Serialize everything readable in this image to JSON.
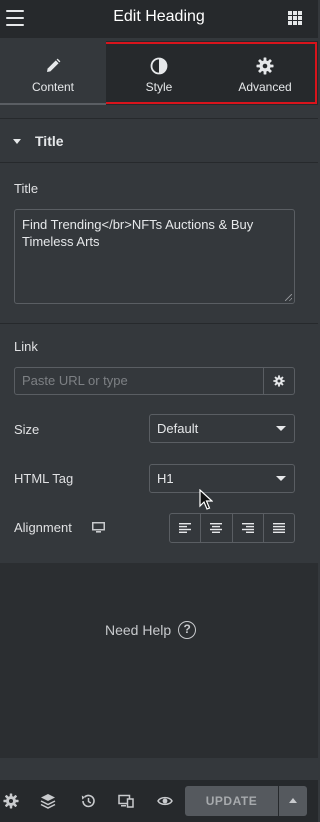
{
  "header": {
    "title": "Edit Heading",
    "menu_icon": "hamburger-icon",
    "apps_icon": "grid-icon"
  },
  "tabs": [
    {
      "label": "Content",
      "icon": "pencil-icon",
      "active": true
    },
    {
      "label": "Style",
      "icon": "contrast-icon",
      "active": false
    },
    {
      "label": "Advanced",
      "icon": "gear-icon",
      "active": false
    }
  ],
  "highlight_color": "#d8141c",
  "section": {
    "title": "Title"
  },
  "title_field": {
    "label": "Title",
    "value": "Find Trending</br>NFTs Auctions & Buy Timeless Arts"
  },
  "link_field": {
    "label": "Link",
    "placeholder": "Paste URL or type"
  },
  "size_field": {
    "label": "Size",
    "value": "Default"
  },
  "html_tag_field": {
    "label": "HTML Tag",
    "value": "H1"
  },
  "alignment_field": {
    "label": "Alignment",
    "options": [
      "left",
      "center",
      "right",
      "justify"
    ]
  },
  "help": {
    "label": "Need Help"
  },
  "footer": {
    "update_label": "UPDATE"
  }
}
